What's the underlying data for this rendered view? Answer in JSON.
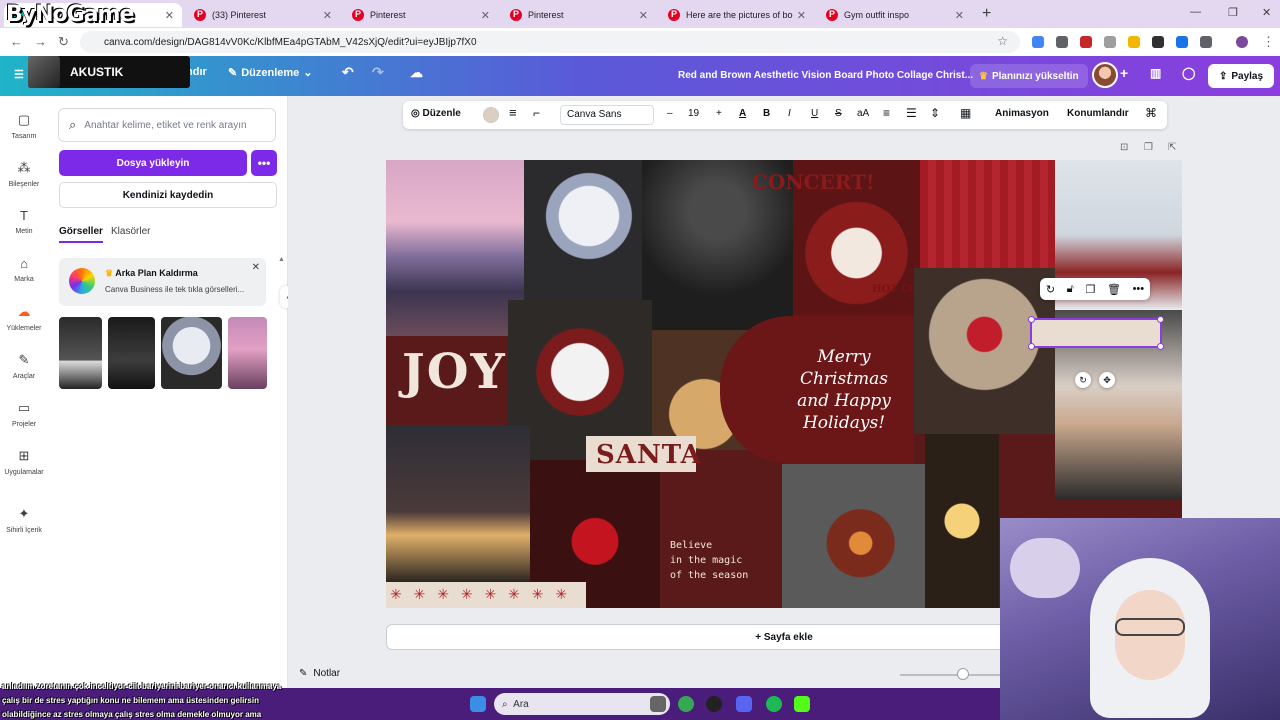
{
  "overlay": {
    "logo": "ByNoGame",
    "music_title": "AKUSTIK"
  },
  "browser": {
    "tabs": [
      {
        "title": "",
        "active": true
      },
      {
        "title": "(33) Pinterest"
      },
      {
        "title": "Pinterest"
      },
      {
        "title": "Pinterest"
      },
      {
        "title": "Here are the pictures of body g"
      },
      {
        "title": "Gym outfit inspo"
      }
    ],
    "url": "canva.com/design/DAG814vV0Kc/KlbfMEa4pGTAbM_V42sXjQ/edit?ui=eyJBIjp7fX0"
  },
  "canva_header": {
    "file_fragment": "ndır",
    "edit_label": "Düzenleme",
    "doc_title": "Red and Brown Aesthetic Vision Board Photo Collage Christ...",
    "upgrade_label": "Planınızı yükseltin",
    "share_label": "Paylaş"
  },
  "rail": [
    {
      "label": "Tasarım",
      "icon": "layout-icon"
    },
    {
      "label": "Bileşenler",
      "icon": "elements-icon"
    },
    {
      "label": "Metin",
      "icon": "text-icon"
    },
    {
      "label": "Marka",
      "icon": "brand-icon"
    },
    {
      "label": "Yüklemeler",
      "icon": "upload-icon"
    },
    {
      "label": "Araçlar",
      "icon": "tools-icon"
    },
    {
      "label": "Projeler",
      "icon": "folder-icon"
    },
    {
      "label": "Uygulamalar",
      "icon": "apps-icon"
    },
    {
      "label": "Sihirli İçerik",
      "icon": "magic-icon"
    }
  ],
  "panel": {
    "search_placeholder": "Anahtar kelime, etiket ve renk arayın",
    "upload_label": "Dosya yükleyin",
    "more_label": "•••",
    "save_label": "Kendinizi kaydedin",
    "tab_images": "Görseller",
    "tab_folders": "Klasörler",
    "promo_title": "Arka Plan Kaldırma",
    "promo_text": "Canva Business ile tek tıkla görselleri..."
  },
  "toolbar": {
    "edit_label": "Düzenle",
    "font": "Canva Sans",
    "minus": "–",
    "size": "19",
    "plus": "+",
    "color_letter": "A",
    "bold": "B",
    "italic": "I",
    "underline": "U",
    "strike": "S",
    "case": "aA",
    "animate_label": "Animasyon",
    "position_label": "Konumlandır"
  },
  "collage": {
    "concert": "CONCERT!",
    "joy": "JOY",
    "santa": "SANTA",
    "merry": "Merry Christmas and Happy Holidays!",
    "believe": "Believe\nin the magic\nof the season",
    "hot_cocoa": "HOT COCOA",
    "stars": "✳ ✳ ✳ ✳ ✳ ✳ ✳ ✳"
  },
  "footer": {
    "add_page": "+ Sayfa ekle",
    "notes": "Notlar"
  },
  "chat_text": "anladıım zoretanın çok inceltiyor ciit bariyerini bariyer onarıcı kullanmaya çalış bir de stres yaptığın konu ne bilemem ama üstesinden gelirsin olabildiğince az stres olmaya çalış stres olma demekle olmuyor ama",
  "taskbar": {
    "search_placeholder": "Ara"
  },
  "colors": {
    "accent": "#7d2ae8",
    "header_start": "#1fb4c8",
    "header_end": "#8b3dde",
    "collage_red": "#5a1a1a"
  }
}
